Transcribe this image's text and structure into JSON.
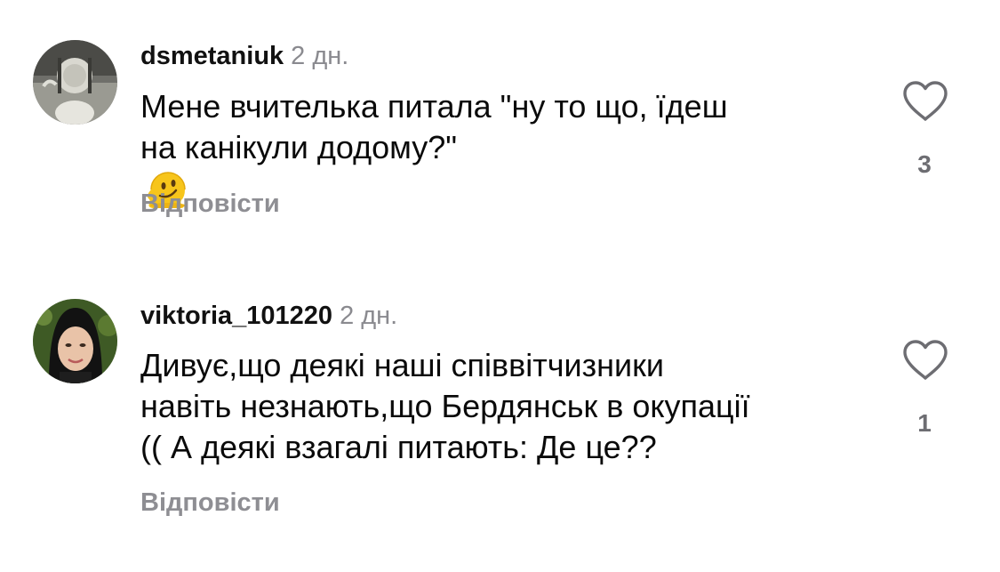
{
  "comments": [
    {
      "username": "dsmetaniuk",
      "time": "2 дн.",
      "lines": [
        "Мене вчителька питала \"ну то що, їдеш",
        "на канікули додому?\""
      ],
      "emoji": "melting-face",
      "reply_label": "Відповісти",
      "likes": "3"
    },
    {
      "username": "viktoria_101220",
      "time": "2 дн.",
      "lines": [
        "Дивує,що деякі наші співвітчизники",
        "навіть незнають,що Бердянськ в окупації",
        "(( А деякі взагалі питають: Де  це??"
      ],
      "reply_label": "Відповісти",
      "likes": "1"
    }
  ],
  "colors": {
    "text": "#0a0a0a",
    "secondary": "#8e8e93",
    "icon": "#6d6d72",
    "background": "#ffffff"
  }
}
